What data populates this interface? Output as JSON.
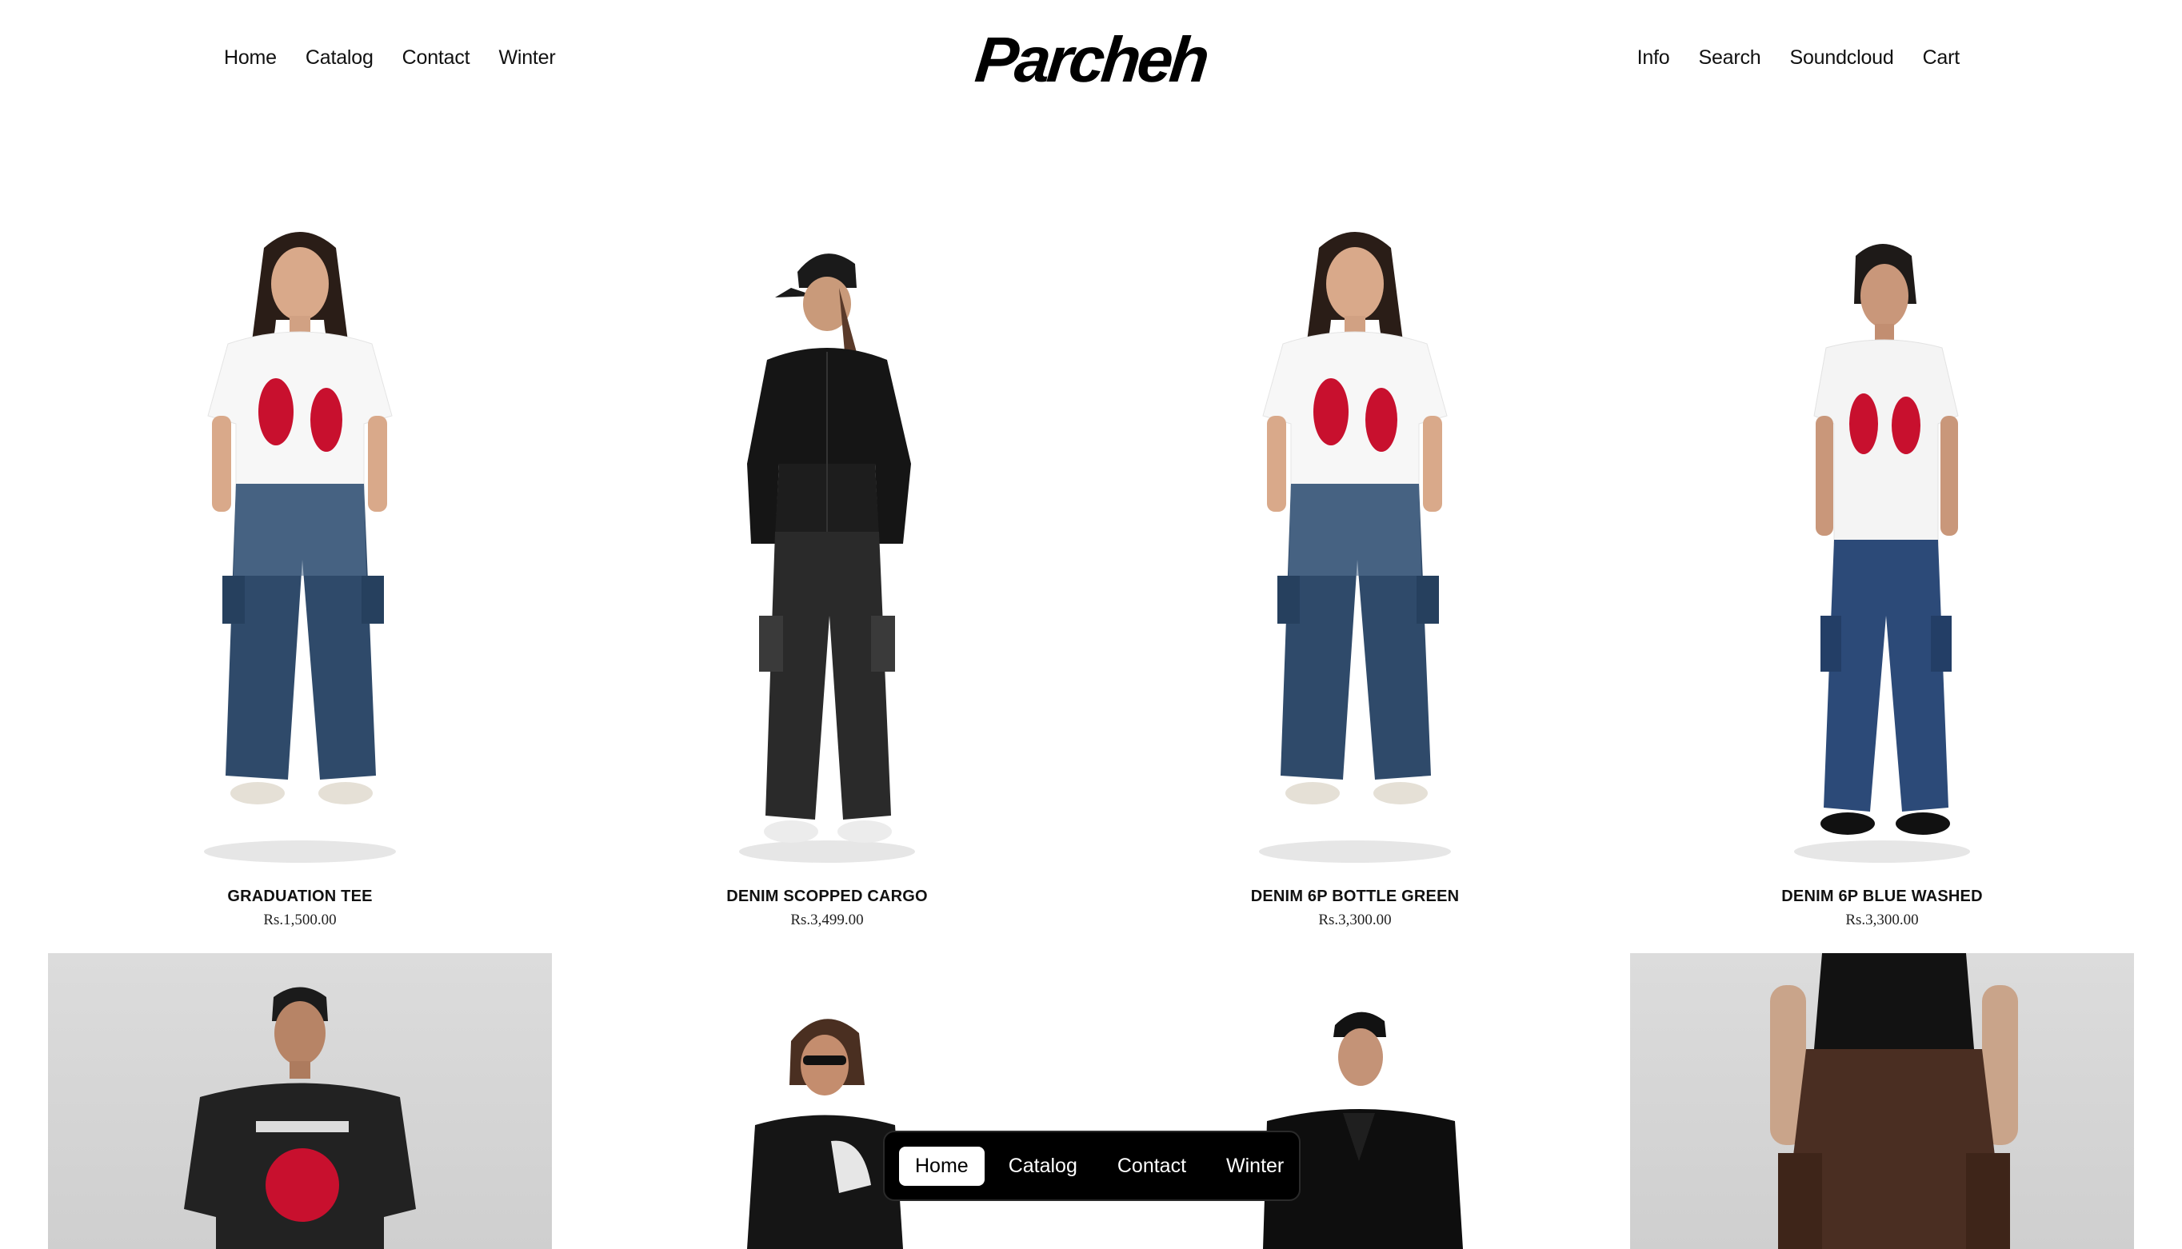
{
  "header": {
    "logo": "Parcheh",
    "nav_left": [
      "Home",
      "Catalog",
      "Contact",
      "Winter"
    ],
    "nav_right": [
      "Info",
      "Search",
      "Soundcloud",
      "Cart"
    ]
  },
  "products": [
    {
      "title": "GRADUATION TEE",
      "price": "Rs.1,500.00"
    },
    {
      "title": "DENIM SCOPPED CARGO",
      "price": "Rs.3,499.00"
    },
    {
      "title": "DENIM 6P BOTTLE GREEN",
      "price": "Rs.3,300.00"
    },
    {
      "title": "DENIM 6P BLUE WASHED",
      "price": "Rs.3,300.00"
    }
  ],
  "floating_nav": {
    "items": [
      "Home",
      "Catalog",
      "Contact",
      "Winter"
    ],
    "active": "Home"
  },
  "colors": {
    "background": "#ffffff",
    "text": "#111111",
    "floating_bg": "#000000",
    "denim_blue": "#2f4a6a",
    "tee_red": "#c8102e",
    "cargo_brown": "#4a2e22"
  }
}
